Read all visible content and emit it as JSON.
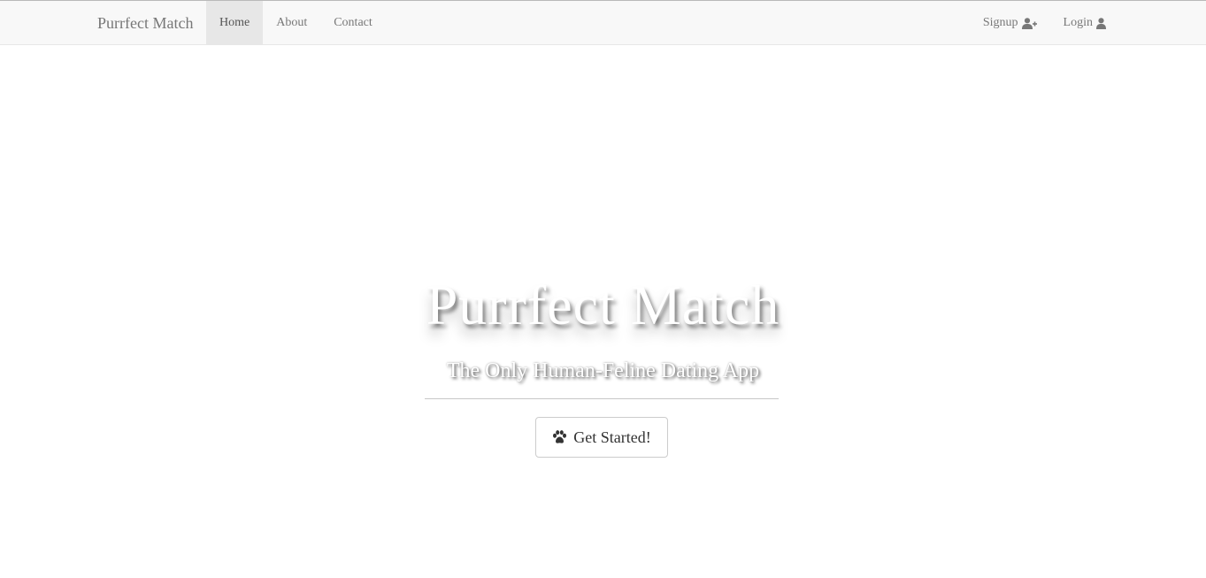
{
  "nav": {
    "brand": "Purrfect Match",
    "left_links": [
      {
        "label": "Home",
        "active": true
      },
      {
        "label": "About",
        "active": false
      },
      {
        "label": "Contact",
        "active": false
      }
    ],
    "right_links": [
      {
        "label": "Signup",
        "icon": "user-plus-icon"
      },
      {
        "label": "Login",
        "icon": "user-icon"
      }
    ]
  },
  "hero": {
    "title": "Purrfect Match",
    "subtitle": "The Only Human-Feline Dating App",
    "cta_label": "Get Started!",
    "cta_icon": "paw-icon"
  },
  "colors": {
    "navbar_bg": "#f8f8f8",
    "nav_text": "#777777",
    "active_bg": "#e7e7e7",
    "button_border": "#cccccc",
    "button_text": "#333333"
  }
}
